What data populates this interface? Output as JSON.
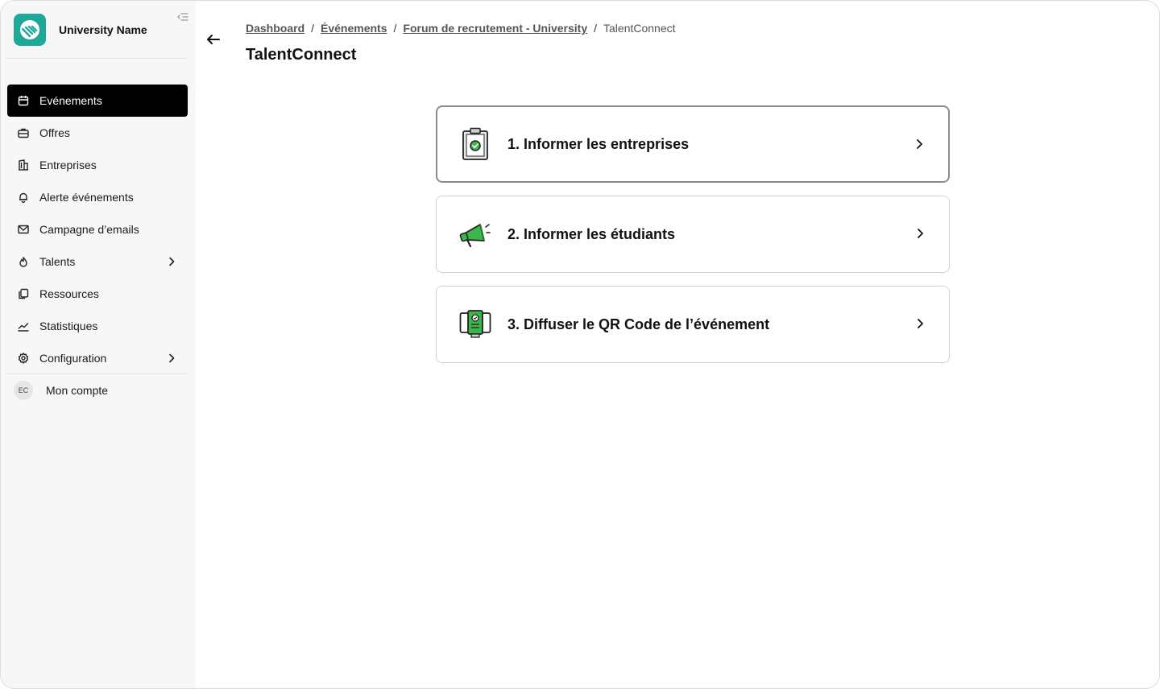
{
  "sidebar": {
    "brand_name": "University Name",
    "items": [
      {
        "label": "Evénements",
        "icon": "calendar-icon",
        "active": true
      },
      {
        "label": "Offres",
        "icon": "briefcase-icon"
      },
      {
        "label": "Entreprises",
        "icon": "building-icon"
      },
      {
        "label": "Alerte événements",
        "icon": "bell-icon"
      },
      {
        "label": "Campagne d’emails",
        "icon": "mail-icon"
      },
      {
        "label": "Talents",
        "icon": "flame-icon",
        "has_submenu": true
      },
      {
        "label": "Ressources",
        "icon": "copy-icon"
      },
      {
        "label": "Statistiques",
        "icon": "chart-icon"
      },
      {
        "label": "Configuration",
        "icon": "gear-icon",
        "has_submenu": true
      }
    ],
    "account": {
      "initials": "EC",
      "label": "Mon compte"
    }
  },
  "breadcrumb": {
    "items": [
      "Dashboard",
      "Événements",
      "Forum de recrutement - University"
    ],
    "current": "TalentConnect",
    "separator": "/"
  },
  "page": {
    "title": "TalentConnect"
  },
  "cards": [
    {
      "label": "1. Informer les entreprises",
      "icon": "clipboard-check-icon"
    },
    {
      "label": "2. Informer les étudiants",
      "icon": "megaphone-icon"
    },
    {
      "label": "3. Diffuser le QR Code de l’événement",
      "icon": "qr-screen-icon"
    }
  ],
  "colors": {
    "brand": "#1fa79a",
    "accent_green": "#3cb64a",
    "active_nav": "#000000"
  }
}
